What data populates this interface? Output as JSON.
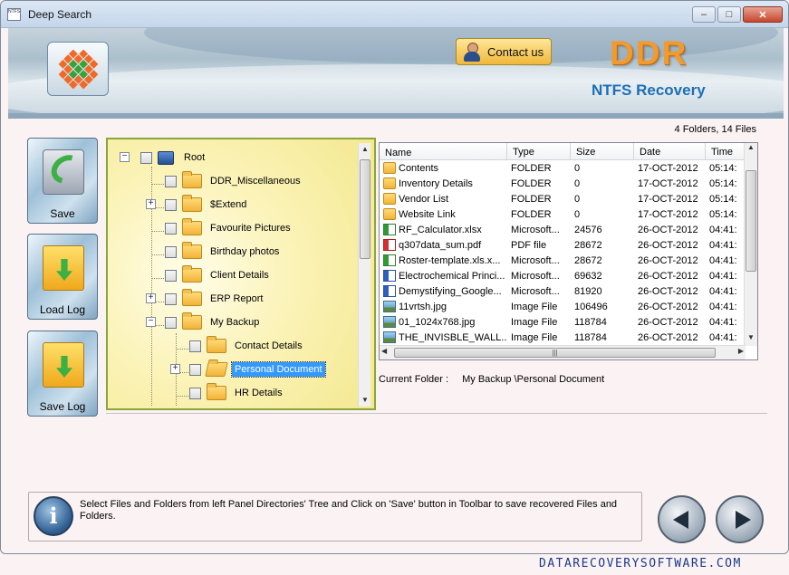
{
  "window": {
    "title": "Deep Search",
    "app_icon_text": "NTFS",
    "controls": {
      "minimize": "–",
      "maximize": "□",
      "close": "✕"
    }
  },
  "banner": {
    "contact_label": "Contact us",
    "brand": "DDR",
    "product": "NTFS Recovery"
  },
  "summary": "4 Folders, 14 Files",
  "toolbar": {
    "save_label": "Save",
    "load_log_label": "Load Log",
    "save_log_label": "Save Log"
  },
  "tree": {
    "root": "Root",
    "nodes": [
      "DDR_Miscellaneous",
      "$Extend",
      "Favourite Pictures",
      "Birthday photos",
      "Client Details",
      "ERP Report",
      "My Backup",
      "Contact Details",
      "Personal Document",
      "HR Details"
    ],
    "selected": "Personal Document"
  },
  "file_list": {
    "columns": [
      "Name",
      "Type",
      "Size",
      "Date",
      "Time"
    ],
    "rows": [
      {
        "name": "Contents",
        "type": "FOLDER",
        "size": "0",
        "date": "17-OCT-2012",
        "time": "05:14:",
        "icon": "folder"
      },
      {
        "name": "Inventory Details",
        "type": "FOLDER",
        "size": "0",
        "date": "17-OCT-2012",
        "time": "05:14:",
        "icon": "folder"
      },
      {
        "name": "Vendor List",
        "type": "FOLDER",
        "size": "0",
        "date": "17-OCT-2012",
        "time": "05:14:",
        "icon": "folder"
      },
      {
        "name": "Website Link",
        "type": "FOLDER",
        "size": "0",
        "date": "17-OCT-2012",
        "time": "05:14:",
        "icon": "folder"
      },
      {
        "name": "RF_Calculator.xlsx",
        "type": "Microsoft...",
        "size": "24576",
        "date": "26-OCT-2012",
        "time": "04:41:",
        "icon": "xlsx"
      },
      {
        "name": "q307data_sum.pdf",
        "type": "PDF file",
        "size": "28672",
        "date": "26-OCT-2012",
        "time": "04:41:",
        "icon": "pdf"
      },
      {
        "name": "Roster-template.xls.x...",
        "type": "Microsoft...",
        "size": "28672",
        "date": "26-OCT-2012",
        "time": "04:41:",
        "icon": "xlsx"
      },
      {
        "name": "Electrochemical Princi...",
        "type": "Microsoft...",
        "size": "69632",
        "date": "26-OCT-2012",
        "time": "04:41:",
        "icon": "doc"
      },
      {
        "name": "Demystifying_Google...",
        "type": "Microsoft...",
        "size": "81920",
        "date": "26-OCT-2012",
        "time": "04:41:",
        "icon": "doc"
      },
      {
        "name": "11vrtsh.jpg",
        "type": "Image File",
        "size": "106496",
        "date": "26-OCT-2012",
        "time": "04:41:",
        "icon": "img"
      },
      {
        "name": "01_1024x768.jpg",
        "type": "Image File",
        "size": "118784",
        "date": "26-OCT-2012",
        "time": "04:41:",
        "icon": "img"
      },
      {
        "name": "THE_INVISBLE_WALL...",
        "type": "Image File",
        "size": "118784",
        "date": "26-OCT-2012",
        "time": "04:41:",
        "icon": "img"
      }
    ]
  },
  "current_folder": {
    "label": "Current Folder :",
    "value": "My Backup \\Personal Document"
  },
  "status": {
    "info_icon": "i",
    "text": "Select Files and Folders from left Panel Directories' Tree and Click on 'Save' button in Toolbar to save recovered Files and Folders."
  },
  "footer": {
    "website": "DATARECOVERYSOFTWARE.COM"
  }
}
